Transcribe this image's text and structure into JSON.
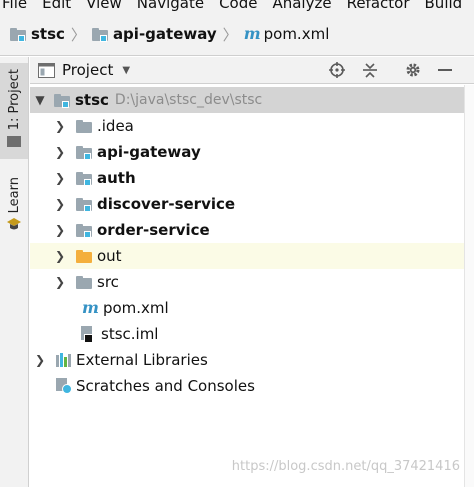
{
  "menubar": {
    "items": [
      "File",
      "Edit",
      "View",
      "Navigate",
      "Code",
      "Analyze",
      "Refactor",
      "Build"
    ]
  },
  "breadcrumb": {
    "items": [
      {
        "label": "stsc",
        "icon": "module-folder-icon"
      },
      {
        "label": "api-gateway",
        "icon": "module-folder-icon"
      },
      {
        "label": "pom.xml",
        "icon": "maven-icon"
      }
    ]
  },
  "left_stripe": {
    "project_tab": "1: Project",
    "learn_tab": "Learn"
  },
  "panel": {
    "title": "Project",
    "tools": [
      "locate-icon",
      "collapse-all-icon",
      "settings-gear-icon",
      "hide-minus-icon"
    ]
  },
  "tree": {
    "root": {
      "name": "stsc",
      "path": "D:\\java\\stsc_dev\\stsc"
    },
    "children": [
      {
        "name": ".idea",
        "bold": false,
        "type": "folder"
      },
      {
        "name": "api-gateway",
        "bold": true,
        "type": "module"
      },
      {
        "name": "auth",
        "bold": true,
        "type": "module"
      },
      {
        "name": "discover-service",
        "bold": true,
        "type": "module"
      },
      {
        "name": "order-service",
        "bold": true,
        "type": "module"
      },
      {
        "name": "out",
        "bold": false,
        "type": "excluded-folder"
      },
      {
        "name": "src",
        "bold": false,
        "type": "folder"
      },
      {
        "name": "pom.xml",
        "bold": false,
        "type": "maven-file"
      },
      {
        "name": "stsc.iml",
        "bold": false,
        "type": "iml-file"
      }
    ],
    "external_libraries": "External Libraries",
    "scratches": "Scratches and Consoles"
  },
  "watermark": "https://blog.csdn.net/qq_37421416",
  "colors": {
    "folder": "#9aa7b0",
    "module_mark": "#40b6e0",
    "excluded_folder": "#f4af3d",
    "maven": "#3592c4",
    "selection": "#d4d4d4"
  }
}
